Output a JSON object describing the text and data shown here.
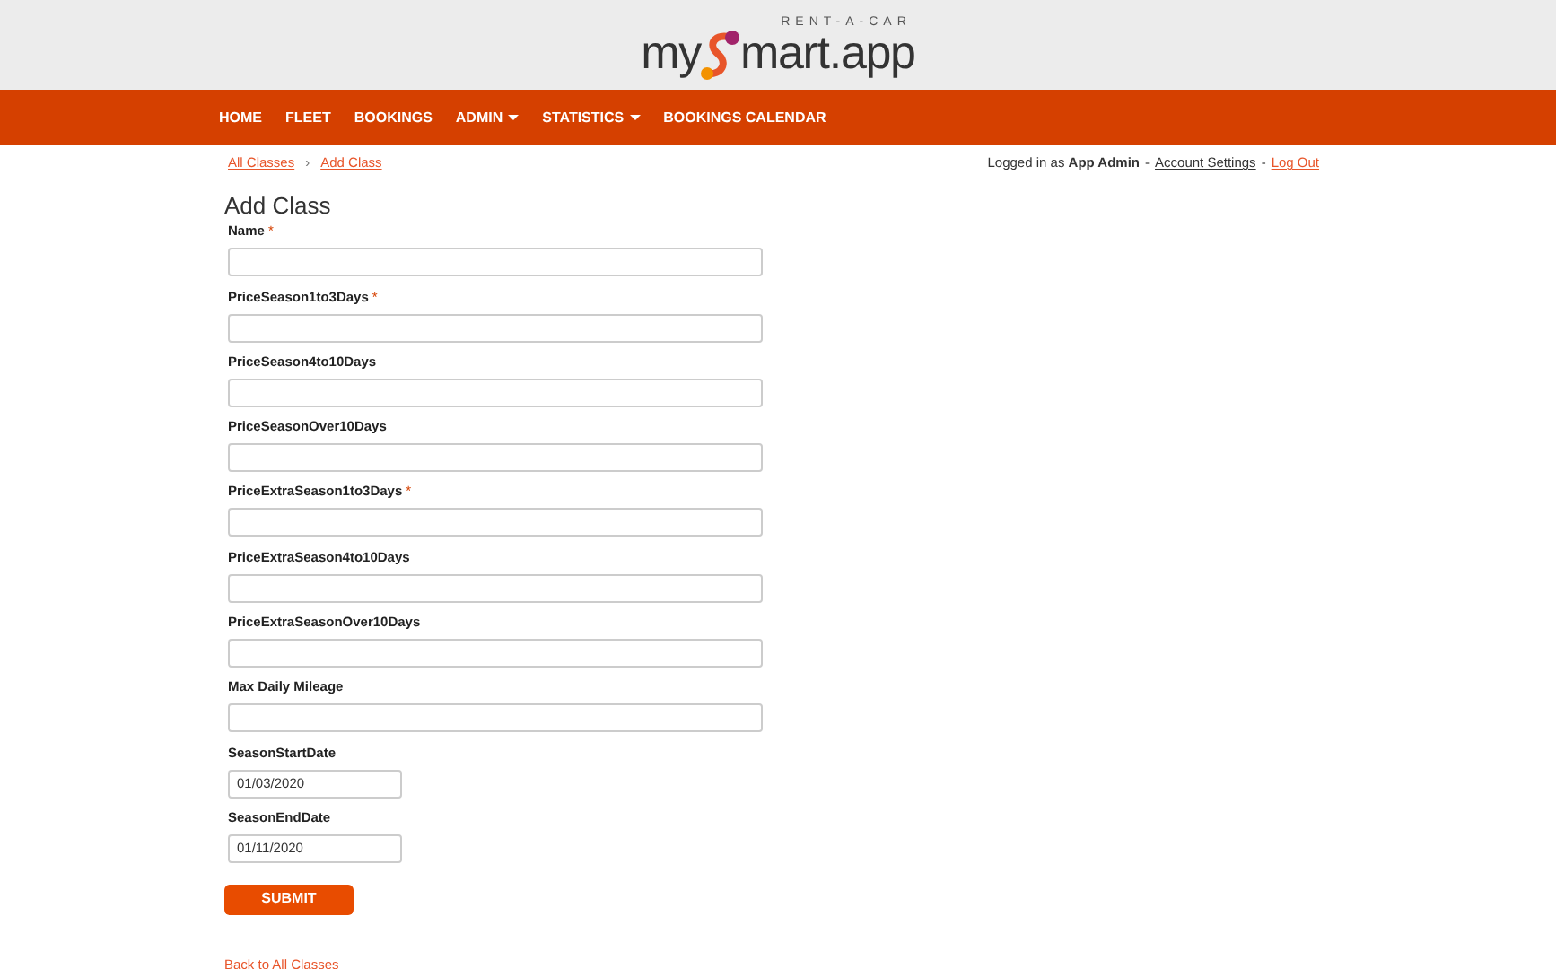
{
  "logo": {
    "tagline": "RENT-A-CAR",
    "text_before": "my",
    "text_after": "mart.app"
  },
  "nav": [
    {
      "label": "HOME",
      "dropdown": false
    },
    {
      "label": "FLEET",
      "dropdown": false
    },
    {
      "label": "BOOKINGS",
      "dropdown": false
    },
    {
      "label": "ADMIN",
      "dropdown": true
    },
    {
      "label": "STATISTICS",
      "dropdown": true
    },
    {
      "label": "BOOKINGS CALENDAR",
      "dropdown": false
    }
  ],
  "breadcrumb": [
    "All Classes",
    "Add Class"
  ],
  "breadcrumb_separator": "›",
  "user_bar": {
    "prefix": "Logged in as",
    "user": "App Admin",
    "separator": "-",
    "links": [
      "Account Settings",
      "Log Out"
    ]
  },
  "required_mark": "*",
  "heading": "Add Class",
  "fields": [
    {
      "label": "Name",
      "required": true,
      "kind": "text"
    },
    {
      "label": "PriceSeason1to3Days",
      "required": true,
      "kind": "text"
    },
    {
      "label": "PriceSeason4to10Days",
      "required": false,
      "kind": "text"
    },
    {
      "label": "PriceSeasonOver10Days",
      "required": false,
      "kind": "text"
    },
    {
      "label": "PriceExtraSeason1to3Days",
      "required": true,
      "kind": "text"
    },
    {
      "label": "PriceExtraSeason4to10Days",
      "required": false,
      "kind": "text"
    },
    {
      "label": "PriceExtraSeasonOver10Days",
      "required": false,
      "kind": "text"
    },
    {
      "label": "Max Daily Mileage",
      "required": false,
      "kind": "text"
    },
    {
      "label": "SeasonStartDate",
      "required": false,
      "kind": "date",
      "value": "01/03/2020"
    },
    {
      "label": "SeasonEndDate",
      "required": false,
      "kind": "date",
      "value": "01/11/2020"
    }
  ],
  "submit": "SUBMIT",
  "back_link": "Back to All Classes"
}
